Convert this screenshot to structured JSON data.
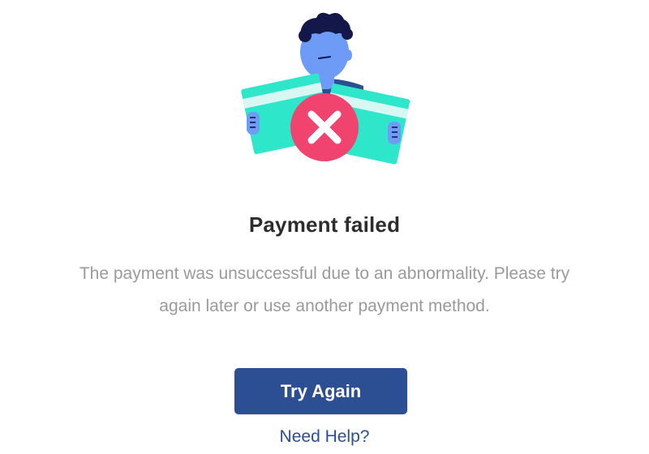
{
  "illustration": {
    "icon": "payment-failed-illustration",
    "status_icon": "close-icon",
    "colors": {
      "card": "#2ee6c9",
      "card_stripe": "#d6f7f2",
      "skin": "#6d9bf5",
      "hair": "#14174a",
      "shirt": "#2c4e93",
      "error_badge": "#f0436e"
    }
  },
  "title": "Payment failed",
  "message_line1": "The payment was unsuccessful due to an abnormality. Please try",
  "message_line2": "again later or use another payment method.",
  "try_again_label": "Try Again",
  "help_label": "Need Help?",
  "colors": {
    "primary": "#2c4e93",
    "title": "#2d2d2d",
    "message": "#9a9a9a"
  }
}
